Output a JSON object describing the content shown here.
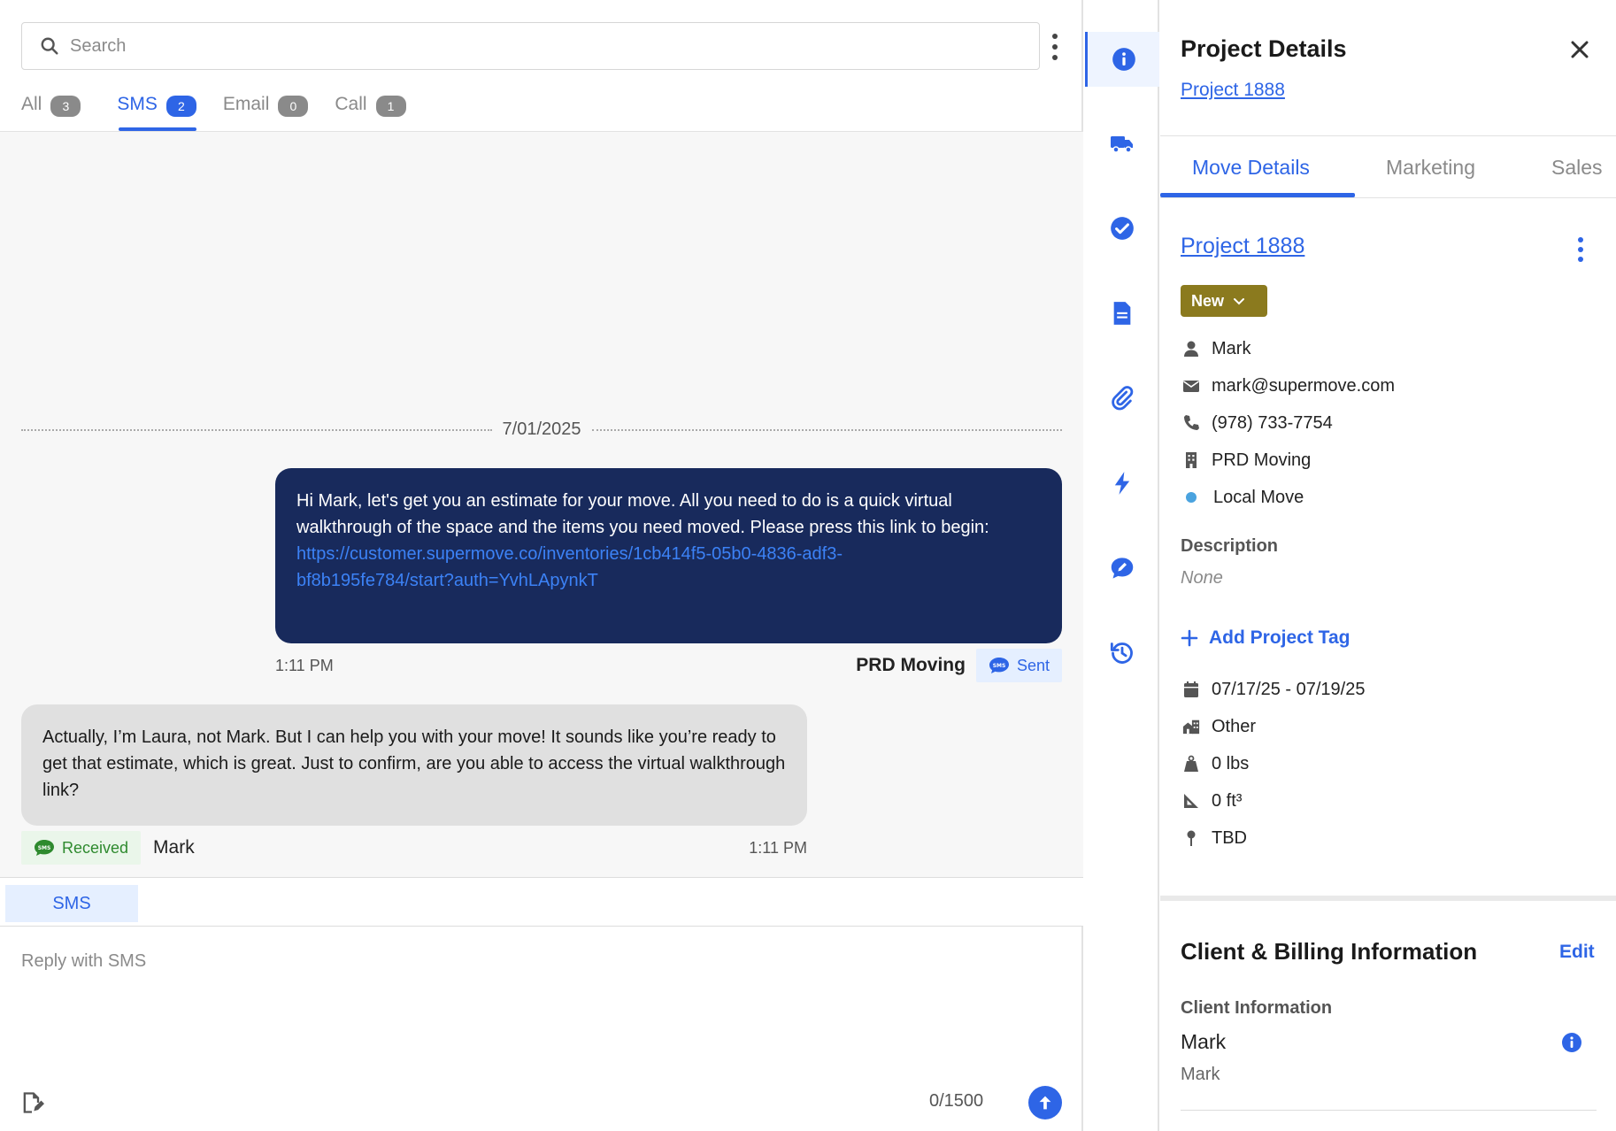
{
  "search": {
    "placeholder": "Search"
  },
  "tabs": [
    {
      "label": "All",
      "count": "3"
    },
    {
      "label": "SMS",
      "count": "2"
    },
    {
      "label": "Email",
      "count": "0"
    },
    {
      "label": "Call",
      "count": "1"
    }
  ],
  "thread": {
    "date": "7/01/2025",
    "outgoing": {
      "text": "Hi Mark, let's get you an estimate for your move. All you need to do is a quick virtual walkthrough of the space and the items you need moved. Please press this link to begin:",
      "link_line1": "https://customer.supermove.co/inventories/1cb414f5-05b0-4836-adf3-",
      "link_line2": "bf8b195fe784/start?auth=YvhLApynkT",
      "time": "1:11 PM",
      "sender": "PRD Moving",
      "status": "Sent",
      "status_icon": "sms-icon"
    },
    "incoming": {
      "text": "Actually, I’m Laura, not Mark. But I can help you with your move! It sounds like you’re ready to get that estimate, which is great. Just to confirm, are you able to access the virtual walkthrough link?",
      "status": "Received",
      "sender": "Mark",
      "time": "1:11 PM",
      "status_icon": "sms-icon"
    }
  },
  "composer": {
    "tab_label": "SMS",
    "placeholder": "Reply with SMS",
    "counter": "0/1500"
  },
  "rail": {
    "icons": [
      "info-icon",
      "truck-icon",
      "check-circle-icon",
      "document-icon",
      "paperclip-icon",
      "bolt-icon",
      "chat-edit-icon",
      "history-icon"
    ],
    "active": "info-icon"
  },
  "details": {
    "title": "Project Details",
    "project_link": "Project 1888",
    "tabs": [
      "Move Details",
      "Marketing",
      "Sales"
    ],
    "project_title": "Project 1888",
    "status": "New",
    "client_name": "Mark",
    "email": "mark@supermove.com",
    "phone": "(978) 733-7754",
    "company": "PRD Moving",
    "move_type": "Local Move",
    "move_type_color": "#4aa3df",
    "description_label": "Description",
    "description_value": "None",
    "add_tag": "Add Project Tag",
    "dates": "07/17/25 - 07/19/25",
    "building": "Other",
    "weight": "0 lbs",
    "volume": "0 ft³",
    "location": "TBD"
  },
  "billing": {
    "title": "Client & Billing Information",
    "edit_label": "Edit",
    "client_info_label": "Client Information",
    "client_name": "Mark",
    "client_sub": "Mark"
  },
  "colors": {
    "accent": "#2e65e6",
    "outgoing_bubble": "#182a5c",
    "incoming_bubble": "#e0e0e0",
    "status_new": "#8b7a1e"
  }
}
